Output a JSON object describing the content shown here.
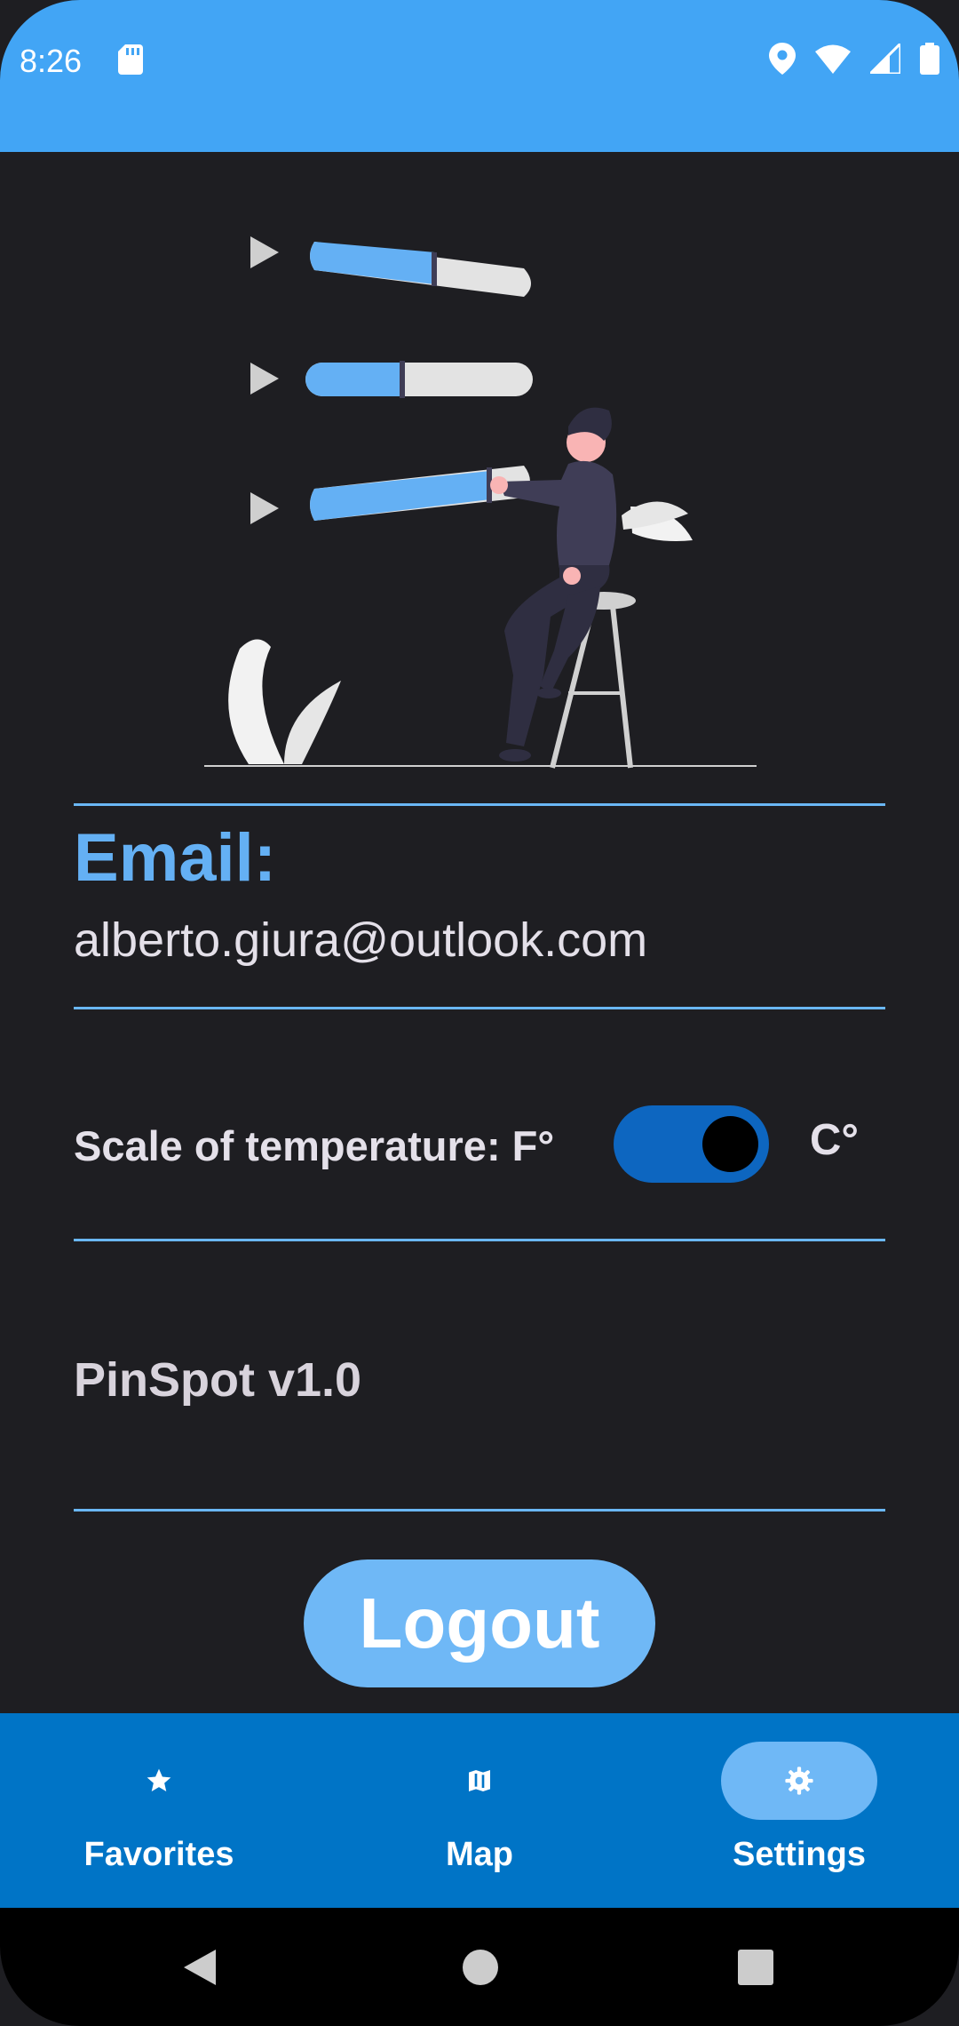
{
  "status_bar": {
    "time": "8:26",
    "icons": [
      "sd-card-icon",
      "location-icon",
      "wifi-icon",
      "signal-icon",
      "battery-icon"
    ],
    "background": "#42a5f5"
  },
  "account": {
    "email_label": "Email:",
    "email_value": "alberto.giura@outlook.com"
  },
  "temperature": {
    "label": "Scale of temperature: F°",
    "toggle_on": true,
    "celsius_label": "C°"
  },
  "app": {
    "version": "PinSpot v1.0"
  },
  "actions": {
    "logout_label": "Logout"
  },
  "bottom_nav": {
    "items": [
      {
        "label": "Favorites",
        "icon": "star-icon",
        "active": false
      },
      {
        "label": "Map",
        "icon": "map-icon",
        "active": false
      },
      {
        "label": "Settings",
        "icon": "gear-icon",
        "active": true
      }
    ]
  },
  "colors": {
    "accent": "#64b0f4",
    "background": "#1e1e22",
    "nav_background": "#0074c6",
    "toggle_track": "#0d66c0"
  }
}
